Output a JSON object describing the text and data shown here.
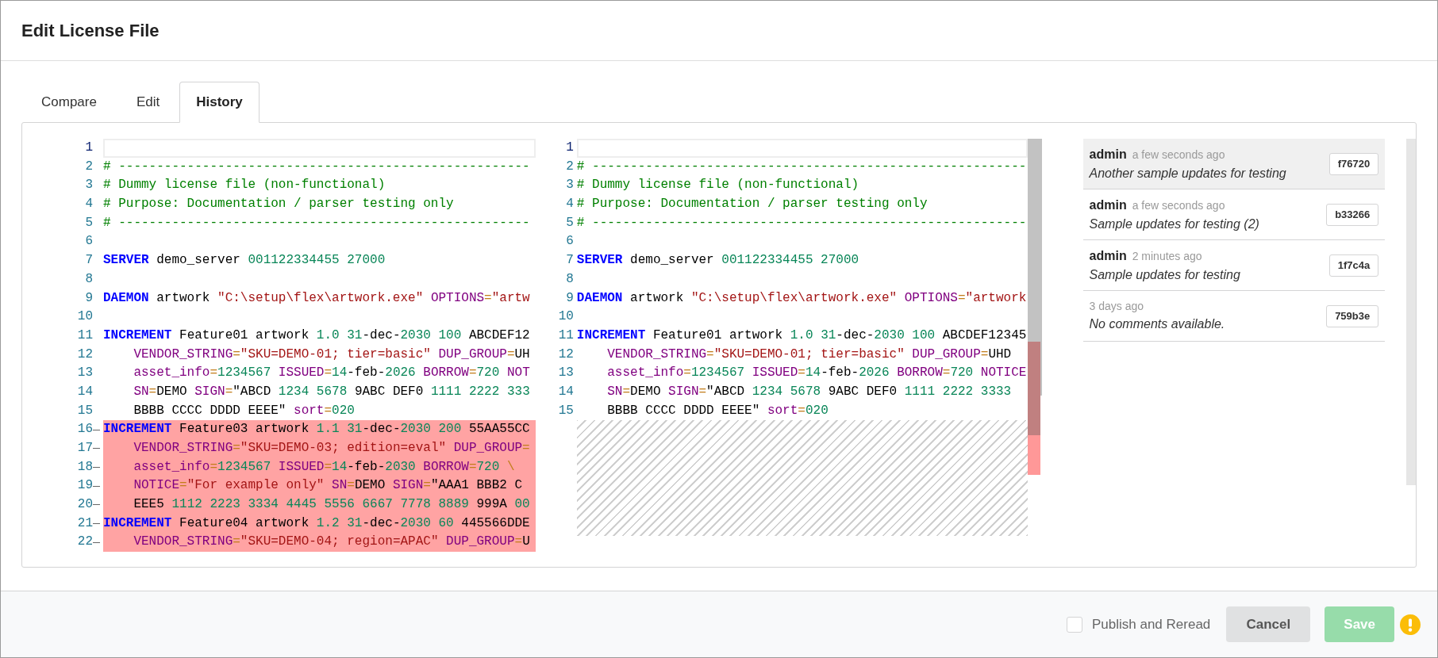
{
  "window": {
    "title": "Edit License File"
  },
  "tabs": [
    {
      "label": "Compare",
      "selected": false
    },
    {
      "label": "Edit",
      "selected": false
    },
    {
      "label": "History",
      "selected": true
    }
  ],
  "left_editor": {
    "lines": [
      {
        "n": "1",
        "kind": "active"
      },
      {
        "n": "2",
        "kind": "plain",
        "tokens": [
          {
            "kind": "cmt",
            "text": "# ------------------------------------------------------"
          }
        ]
      },
      {
        "n": "3",
        "kind": "plain",
        "tokens": [
          {
            "kind": "cmt",
            "text": "# Dummy license file (non-functional)"
          }
        ]
      },
      {
        "n": "4",
        "kind": "plain",
        "tokens": [
          {
            "kind": "cmt",
            "text": "# Purpose: Documentation / parser testing only"
          }
        ]
      },
      {
        "n": "5",
        "kind": "plain",
        "tokens": [
          {
            "kind": "cmt",
            "text": "# ------------------------------------------------------"
          }
        ]
      },
      {
        "n": "6",
        "kind": "plain"
      },
      {
        "n": "7",
        "kind": "plain",
        "tokens": [
          {
            "kind": "kw",
            "text": "SERVER"
          },
          {
            "kind": "id",
            "text": " demo_server "
          },
          {
            "kind": "num",
            "text": "001122334455 27000"
          }
        ]
      },
      {
        "n": "8",
        "kind": "plain"
      },
      {
        "n": "9",
        "kind": "plain",
        "tokens": [
          {
            "kind": "kw",
            "text": "DAEMON"
          },
          {
            "kind": "id",
            "text": " artwork "
          },
          {
            "kind": "str",
            "text": "\"C:\\setup\\flex\\artwork.exe\" "
          },
          {
            "kind": "attr",
            "text": "OPTIONS"
          },
          {
            "kind": "op",
            "text": "="
          },
          {
            "kind": "str",
            "text": "\"artw"
          }
        ]
      },
      {
        "n": "10",
        "kind": "plain"
      },
      {
        "n": "11",
        "kind": "plain",
        "tokens": [
          {
            "kind": "kw",
            "text": "INCREMENT"
          },
          {
            "kind": "id",
            "text": " Feature01 artwork "
          },
          {
            "kind": "num",
            "text": "1.0 31"
          },
          {
            "kind": "id",
            "text": "-dec-"
          },
          {
            "kind": "num",
            "text": "2030 100"
          },
          {
            "kind": "id",
            "text": " ABCDEF12"
          }
        ]
      },
      {
        "n": "12",
        "kind": "plain",
        "tokens": [
          {
            "kind": "attr",
            "text": "    VENDOR_STRING"
          },
          {
            "kind": "op",
            "text": "="
          },
          {
            "kind": "str",
            "text": "\"SKU=DEMO-01; tier=basic\" "
          },
          {
            "kind": "attr",
            "text": "DUP_GROUP"
          },
          {
            "kind": "op",
            "text": "="
          },
          {
            "kind": "id",
            "text": "UH"
          }
        ]
      },
      {
        "n": "13",
        "kind": "plain",
        "tokens": [
          {
            "kind": "attr",
            "text": "    asset_info"
          },
          {
            "kind": "op",
            "text": "="
          },
          {
            "kind": "num",
            "text": "1234567 "
          },
          {
            "kind": "attr",
            "text": "ISSUED"
          },
          {
            "kind": "op",
            "text": "="
          },
          {
            "kind": "num",
            "text": "14"
          },
          {
            "kind": "id",
            "text": "-feb-"
          },
          {
            "kind": "num",
            "text": "2026 "
          },
          {
            "kind": "attr",
            "text": "BORROW"
          },
          {
            "kind": "op",
            "text": "="
          },
          {
            "kind": "num",
            "text": "720 "
          },
          {
            "kind": "attr",
            "text": "NOT"
          }
        ]
      },
      {
        "n": "14",
        "kind": "plain",
        "tokens": [
          {
            "kind": "attr",
            "text": "    SN"
          },
          {
            "kind": "op",
            "text": "="
          },
          {
            "kind": "id",
            "text": "DEMO "
          },
          {
            "kind": "attr",
            "text": "SIGN"
          },
          {
            "kind": "op",
            "text": "="
          },
          {
            "kind": "id",
            "text": "\"ABCD "
          },
          {
            "kind": "num",
            "text": "1234 5678"
          },
          {
            "kind": "id",
            "text": " 9ABC DEF0 "
          },
          {
            "kind": "num",
            "text": "1111 2222 333"
          }
        ]
      },
      {
        "n": "15",
        "kind": "plain",
        "tokens": [
          {
            "kind": "id",
            "text": "    BBBB CCCC DDDD EEEE\" "
          },
          {
            "kind": "attr",
            "text": "sort"
          },
          {
            "kind": "op",
            "text": "="
          },
          {
            "kind": "num",
            "text": "020"
          }
        ]
      },
      {
        "n": "16",
        "kind": "deleted",
        "tokens": [
          {
            "kind": "kw",
            "text": "INCREMENT"
          },
          {
            "kind": "id",
            "text": " Feature03 artwork "
          },
          {
            "kind": "num",
            "text": "1.1 31"
          },
          {
            "kind": "id",
            "text": "-dec-"
          },
          {
            "kind": "num",
            "text": "2030 200"
          },
          {
            "kind": "id",
            "text": " 55AA55CC"
          }
        ]
      },
      {
        "n": "17",
        "kind": "deleted",
        "tokens": [
          {
            "kind": "attr",
            "text": "    VENDOR_STRING"
          },
          {
            "kind": "op",
            "text": "="
          },
          {
            "kind": "str",
            "text": "\"SKU=DEMO-03; edition=eval\" "
          },
          {
            "kind": "attr",
            "text": "DUP_GROUP"
          },
          {
            "kind": "op",
            "text": "="
          }
        ]
      },
      {
        "n": "18",
        "kind": "deleted",
        "tokens": [
          {
            "kind": "attr",
            "text": "    asset_info"
          },
          {
            "kind": "op",
            "text": "="
          },
          {
            "kind": "num",
            "text": "1234567 "
          },
          {
            "kind": "attr",
            "text": "ISSUED"
          },
          {
            "kind": "op",
            "text": "="
          },
          {
            "kind": "num",
            "text": "14"
          },
          {
            "kind": "id",
            "text": "-feb-"
          },
          {
            "kind": "num",
            "text": "2030 "
          },
          {
            "kind": "attr",
            "text": "BORROW"
          },
          {
            "kind": "op",
            "text": "="
          },
          {
            "kind": "num",
            "text": "720 "
          },
          {
            "kind": "op",
            "text": "\\"
          }
        ]
      },
      {
        "n": "19",
        "kind": "deleted",
        "tokens": [
          {
            "kind": "attr",
            "text": "    NOTICE"
          },
          {
            "kind": "op",
            "text": "="
          },
          {
            "kind": "str",
            "text": "\"For example only\" "
          },
          {
            "kind": "attr",
            "text": "SN"
          },
          {
            "kind": "op",
            "text": "="
          },
          {
            "kind": "id",
            "text": "DEMO "
          },
          {
            "kind": "attr",
            "text": "SIGN"
          },
          {
            "kind": "op",
            "text": "="
          },
          {
            "kind": "id",
            "text": "\"AAA1 BBB2 C"
          }
        ]
      },
      {
        "n": "20",
        "kind": "deleted",
        "tokens": [
          {
            "kind": "id",
            "text": "    EEE5 "
          },
          {
            "kind": "num",
            "text": "1112 2223 3334 4445 5556 6667 7778 8889"
          },
          {
            "kind": "id",
            "text": " 999A "
          },
          {
            "kind": "num",
            "text": "00"
          }
        ]
      },
      {
        "n": "21",
        "kind": "deleted",
        "tokens": [
          {
            "kind": "kw",
            "text": "INCREMENT"
          },
          {
            "kind": "id",
            "text": " Feature04 artwork "
          },
          {
            "kind": "num",
            "text": "1.2 31"
          },
          {
            "kind": "id",
            "text": "-dec-"
          },
          {
            "kind": "num",
            "text": "2030 60"
          },
          {
            "kind": "id",
            "text": " 445566DDE"
          }
        ]
      },
      {
        "n": "22",
        "kind": "deleted",
        "tokens": [
          {
            "kind": "attr",
            "text": "    VENDOR_STRING"
          },
          {
            "kind": "op",
            "text": "="
          },
          {
            "kind": "str",
            "text": "\"SKU=DEMO-04; region=APAC\" "
          },
          {
            "kind": "attr",
            "text": "DUP_GROUP"
          },
          {
            "kind": "op",
            "text": "="
          },
          {
            "kind": "id",
            "text": "U"
          }
        ]
      }
    ]
  },
  "right_editor": {
    "lines": [
      {
        "n": "1",
        "kind": "active"
      },
      {
        "n": "2",
        "kind": "plain",
        "tokens": [
          {
            "kind": "cmt",
            "text": "# ---------------------------------------------------------"
          }
        ]
      },
      {
        "n": "3",
        "kind": "plain",
        "tokens": [
          {
            "kind": "cmt",
            "text": "# Dummy license file (non-functional)"
          }
        ]
      },
      {
        "n": "4",
        "kind": "plain",
        "tokens": [
          {
            "kind": "cmt",
            "text": "# Purpose: Documentation / parser testing only"
          }
        ]
      },
      {
        "n": "5",
        "kind": "plain",
        "tokens": [
          {
            "kind": "cmt",
            "text": "# ---------------------------------------------------------"
          }
        ]
      },
      {
        "n": "6",
        "kind": "plain"
      },
      {
        "n": "7",
        "kind": "plain",
        "tokens": [
          {
            "kind": "kw",
            "text": "SERVER"
          },
          {
            "kind": "id",
            "text": " demo_server "
          },
          {
            "kind": "num",
            "text": "001122334455 27000"
          }
        ]
      },
      {
        "n": "8",
        "kind": "plain"
      },
      {
        "n": "9",
        "kind": "plain",
        "tokens": [
          {
            "kind": "kw",
            "text": "DAEMON"
          },
          {
            "kind": "id",
            "text": " artwork "
          },
          {
            "kind": "str",
            "text": "\"C:\\setup\\flex\\artwork.exe\" "
          },
          {
            "kind": "attr",
            "text": "OPTIONS"
          },
          {
            "kind": "op",
            "text": "="
          },
          {
            "kind": "str",
            "text": "\"artwork"
          }
        ]
      },
      {
        "n": "10",
        "kind": "plain"
      },
      {
        "n": "11",
        "kind": "plain",
        "tokens": [
          {
            "kind": "kw",
            "text": "INCREMENT"
          },
          {
            "kind": "id",
            "text": " Feature01 artwork "
          },
          {
            "kind": "num",
            "text": "1.0 31"
          },
          {
            "kind": "id",
            "text": "-dec-"
          },
          {
            "kind": "num",
            "text": "2030 100"
          },
          {
            "kind": "id",
            "text": " ABCDEF12345"
          }
        ]
      },
      {
        "n": "12",
        "kind": "plain",
        "tokens": [
          {
            "kind": "attr",
            "text": "    VENDOR_STRING"
          },
          {
            "kind": "op",
            "text": "="
          },
          {
            "kind": "str",
            "text": "\"SKU=DEMO-01; tier=basic\" "
          },
          {
            "kind": "attr",
            "text": "DUP_GROUP"
          },
          {
            "kind": "op",
            "text": "="
          },
          {
            "kind": "id",
            "text": "UHD"
          }
        ]
      },
      {
        "n": "13",
        "kind": "plain",
        "tokens": [
          {
            "kind": "attr",
            "text": "    asset_info"
          },
          {
            "kind": "op",
            "text": "="
          },
          {
            "kind": "num",
            "text": "1234567 "
          },
          {
            "kind": "attr",
            "text": "ISSUED"
          },
          {
            "kind": "op",
            "text": "="
          },
          {
            "kind": "num",
            "text": "14"
          },
          {
            "kind": "id",
            "text": "-feb-"
          },
          {
            "kind": "num",
            "text": "2026 "
          },
          {
            "kind": "attr",
            "text": "BORROW"
          },
          {
            "kind": "op",
            "text": "="
          },
          {
            "kind": "num",
            "text": "720 "
          },
          {
            "kind": "attr",
            "text": "NOTICE"
          }
        ]
      },
      {
        "n": "14",
        "kind": "plain",
        "tokens": [
          {
            "kind": "attr",
            "text": "    SN"
          },
          {
            "kind": "op",
            "text": "="
          },
          {
            "kind": "id",
            "text": "DEMO "
          },
          {
            "kind": "attr",
            "text": "SIGN"
          },
          {
            "kind": "op",
            "text": "="
          },
          {
            "kind": "id",
            "text": "\"ABCD "
          },
          {
            "kind": "num",
            "text": "1234 5678"
          },
          {
            "kind": "id",
            "text": " 9ABC DEF0 "
          },
          {
            "kind": "num",
            "text": "1111 2222 3333"
          }
        ]
      },
      {
        "n": "15",
        "kind": "plain",
        "tokens": [
          {
            "kind": "id",
            "text": "    BBBB CCCC DDDD EEEE\" "
          },
          {
            "kind": "attr",
            "text": "sort"
          },
          {
            "kind": "op",
            "text": "="
          },
          {
            "kind": "num",
            "text": "020"
          }
        ]
      }
    ]
  },
  "history": [
    {
      "author": "admin",
      "time": "a few seconds ago",
      "comment": "Another sample updates for testing",
      "revision": "f76720",
      "selected": true
    },
    {
      "author": "admin",
      "time": "a few seconds ago",
      "comment": "Sample updates for testing (2)",
      "revision": "b33266",
      "selected": false
    },
    {
      "author": "admin",
      "time": "2 minutes ago",
      "comment": "Sample updates for testing",
      "revision": "1f7c4a",
      "selected": false
    },
    {
      "time": "3 days ago",
      "comment": "No comments available.",
      "revision": "759b3e",
      "selected": false
    }
  ],
  "footer": {
    "publish": {
      "label": "Publish and Reread",
      "checked": false
    },
    "buttons": [
      {
        "kind": "secondary",
        "label": "Cancel",
        "disabled": false
      },
      {
        "kind": "primary",
        "label": "Save",
        "disabled": true
      }
    ],
    "warning": true
  }
}
